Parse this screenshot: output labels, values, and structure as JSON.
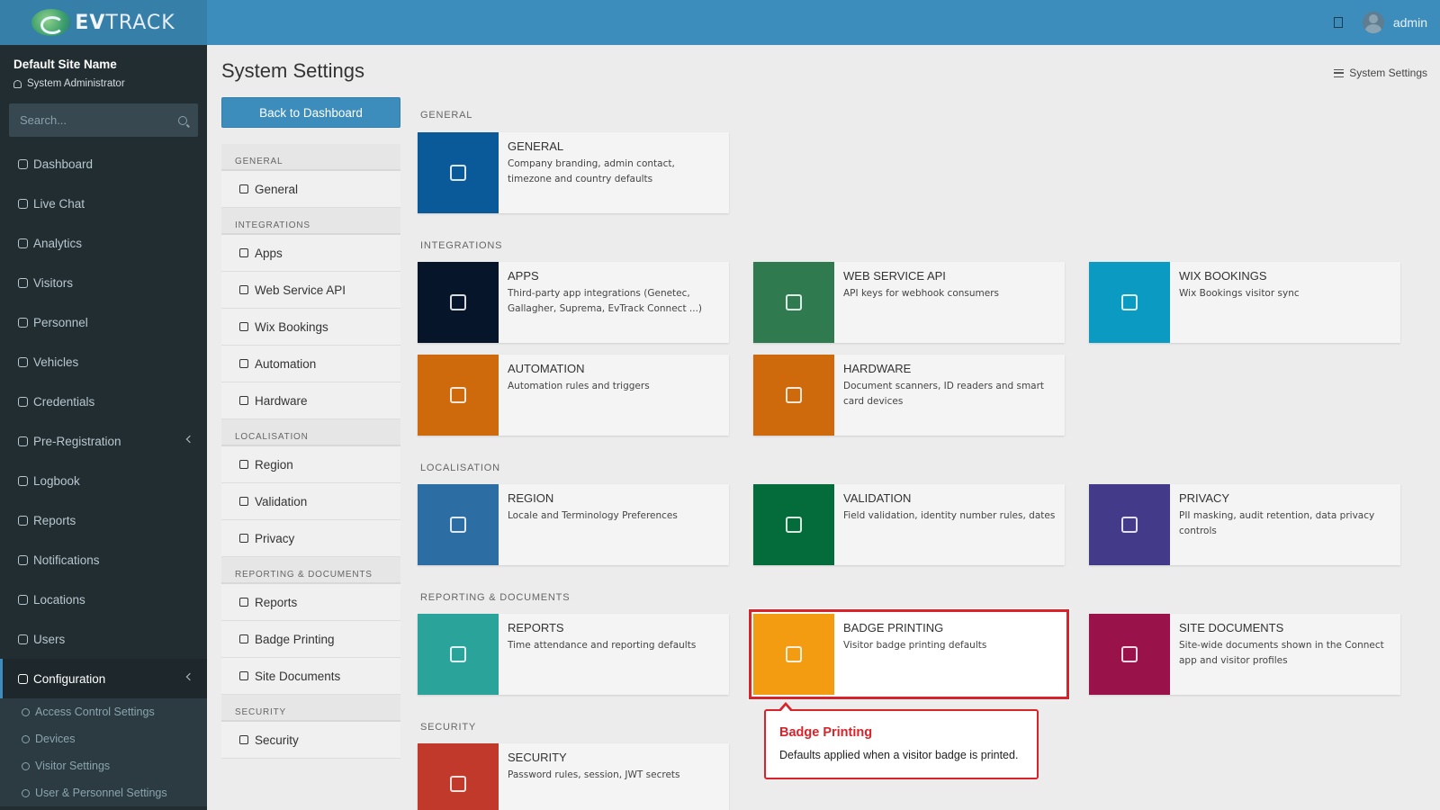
{
  "brand": {
    "prefix": "EV",
    "suffix": "TRACK"
  },
  "topbar": {
    "user": "admin"
  },
  "sidebar": {
    "site_name": "Default Site Name",
    "role": "System Administrator",
    "search_placeholder": "Search...",
    "items": [
      {
        "label": "Dashboard",
        "icon": "dashboard-icon"
      },
      {
        "label": "Live Chat",
        "icon": "headset-icon"
      },
      {
        "label": "Analytics",
        "icon": "target-icon"
      },
      {
        "label": "Visitors",
        "icon": "eye-icon"
      },
      {
        "label": "Personnel",
        "icon": "people-icon"
      },
      {
        "label": "Vehicles",
        "icon": "car-icon"
      },
      {
        "label": "Credentials",
        "icon": "id-card-icon"
      },
      {
        "label": "Pre-Registration",
        "icon": "arrows-icon"
      },
      {
        "label": "Logbook",
        "icon": "book-icon"
      },
      {
        "label": "Reports",
        "icon": "chart-icon"
      },
      {
        "label": "Notifications",
        "icon": "chat-icon"
      },
      {
        "label": "Locations",
        "icon": "building-icon"
      },
      {
        "label": "Users",
        "icon": "users-icon"
      },
      {
        "label": "Configuration",
        "icon": "gear-icon"
      }
    ],
    "sub_items": [
      {
        "label": "Access Control Settings"
      },
      {
        "label": "Devices"
      },
      {
        "label": "Visitor Settings"
      },
      {
        "label": "User & Personnel Settings"
      }
    ]
  },
  "page": {
    "title": "System Settings",
    "breadcrumb": "System Settings",
    "back_label": "Back to Dashboard"
  },
  "settings_menu": {
    "groups": [
      {
        "label": "GENERAL",
        "items": [
          "General"
        ]
      },
      {
        "label": "INTEGRATIONS",
        "items": [
          "Apps",
          "Web Service API",
          "Wix Bookings",
          "Automation",
          "Hardware"
        ]
      },
      {
        "label": "LOCALISATION",
        "items": [
          "Region",
          "Validation",
          "Privacy"
        ]
      },
      {
        "label": "REPORTING & DOCUMENTS",
        "items": [
          "Reports",
          "Badge Printing",
          "Site Documents"
        ]
      },
      {
        "label": "SECURITY",
        "items": [
          "Security"
        ]
      }
    ]
  },
  "sections": {
    "general": "GENERAL",
    "integrations": "INTEGRATIONS",
    "localisation": "LOCALISATION",
    "reporting": "REPORTING & DOCUMENTS",
    "security": "SECURITY"
  },
  "cards": {
    "general": {
      "title": "GENERAL",
      "desc": "Company branding, admin contact, timezone and country defaults",
      "color": "#0a5a99"
    },
    "apps": {
      "title": "APPS",
      "desc": "Third-party app integrations (Genetec, Gallagher, Suprema, EvTrack Connect ...)",
      "color": "#06152a"
    },
    "webapi": {
      "title": "WEB SERVICE API",
      "desc": "API keys for webhook consumers",
      "color": "#2f7a4f"
    },
    "wix": {
      "title": "WIX BOOKINGS",
      "desc": "Wix Bookings visitor sync",
      "color": "#0b9ac2"
    },
    "automation": {
      "title": "AUTOMATION",
      "desc": "Automation rules and triggers",
      "color": "#cf6a0c"
    },
    "hardware": {
      "title": "HARDWARE",
      "desc": "Document scanners, ID readers and smart card devices",
      "color": "#cf6a0c"
    },
    "region": {
      "title": "REGION",
      "desc": "Locale and Terminology Preferences",
      "color": "#2c6ea3"
    },
    "validation": {
      "title": "VALIDATION",
      "desc": "Field validation, identity number rules, dates",
      "color": "#046b3a"
    },
    "privacy": {
      "title": "PRIVACY",
      "desc": "PII masking, audit retention, data privacy controls",
      "color": "#433a8a"
    },
    "reports": {
      "title": "REPORTS",
      "desc": "Time attendance and reporting defaults",
      "color": "#2aa39a"
    },
    "badge": {
      "title": "BADGE PRINTING",
      "desc": "Visitor badge printing defaults",
      "color": "#f39c12"
    },
    "sitedocs": {
      "title": "SITE DOCUMENTS",
      "desc": "Site-wide documents shown in the Connect app and visitor profiles",
      "color": "#99124a"
    },
    "security": {
      "title": "SECURITY",
      "desc": "Password rules, session, JWT secrets",
      "color": "#c0392b"
    }
  },
  "tooltip": {
    "title": "Badge Printing",
    "text": "Defaults applied when a visitor badge is printed."
  }
}
